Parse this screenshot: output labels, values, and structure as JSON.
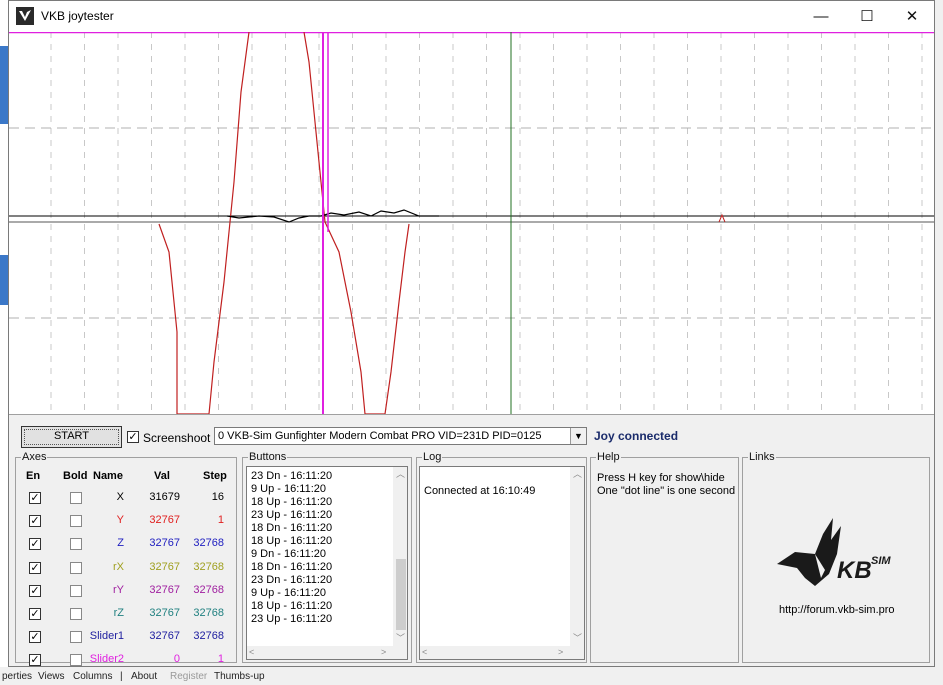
{
  "window": {
    "title": "VKB joytester",
    "minimize_glyph": "—",
    "maximize_glyph": "☐",
    "close_glyph": "✕"
  },
  "background_app": {
    "bottom_items": [
      "perties",
      "Views",
      "Columns",
      "|",
      "About",
      "Register",
      "Thumbs-up"
    ]
  },
  "toolbar": {
    "start_label": "START",
    "screenshot_label": "Screenshoot",
    "screenshot_checked": true,
    "device_value": "0  VKB-Sim Gunfighter Modern Combat PRO  VID=231D PID=0125",
    "status_text": "Joy connected"
  },
  "axes": {
    "title": "Axes",
    "headers": {
      "en": "En",
      "bold": "Bold",
      "name": "Name",
      "val": "Val",
      "step": "Step"
    },
    "rows": [
      {
        "name": "X",
        "val": "31679",
        "step": "16",
        "color": "#000000",
        "enabled": true,
        "bold": false
      },
      {
        "name": "Y",
        "val": "32767",
        "step": "1",
        "color": "#e02020",
        "enabled": true,
        "bold": false
      },
      {
        "name": "Z",
        "val": "32767",
        "step": "32768",
        "color": "#2020c0",
        "enabled": true,
        "bold": false
      },
      {
        "name": "rX",
        "val": "32767",
        "step": "32768",
        "color": "#a0a020",
        "enabled": true,
        "bold": false
      },
      {
        "name": "rY",
        "val": "32767",
        "step": "32768",
        "color": "#a020a0",
        "enabled": true,
        "bold": false
      },
      {
        "name": "rZ",
        "val": "32767",
        "step": "32768",
        "color": "#208080",
        "enabled": true,
        "bold": false
      },
      {
        "name": "Slider1",
        "val": "32767",
        "step": "32768",
        "color": "#2020a0",
        "enabled": true,
        "bold": false
      },
      {
        "name": "Slider2",
        "val": "0",
        "step": "1",
        "color": "#e020e0",
        "enabled": true,
        "bold": false
      }
    ]
  },
  "buttons": {
    "title": "Buttons",
    "events": [
      "23 Dn - 16:11:20",
      "9 Up - 16:11:20",
      "18 Up - 16:11:20",
      "23 Up - 16:11:20",
      "18 Dn - 16:11:20",
      "18 Up - 16:11:20",
      "9 Dn - 16:11:20",
      "18 Dn - 16:11:20",
      "23 Dn - 16:11:20",
      "9 Up - 16:11:20",
      "18 Up - 16:11:20",
      "23 Up - 16:11:20"
    ]
  },
  "log": {
    "title": "Log",
    "lines": [
      "Connected at 16:10:49"
    ]
  },
  "help": {
    "title": "Help",
    "lines": [
      "Press H key for show\\hide",
      "One \"dot line\" is one second"
    ]
  },
  "links": {
    "title": "Links",
    "logo_text": "VKB SIM",
    "url": "http://forum.vkb-sim.pro"
  },
  "colors": {
    "x_trace": "#000000",
    "y_trace": "#c02020",
    "slider2_marker": "#e020e0",
    "time_marker": "#207020",
    "rx_trace": "#a0a020"
  },
  "chart_data": {
    "type": "line",
    "title": "",
    "xlabel": "",
    "ylabel": "",
    "ylim": [
      0,
      65535
    ],
    "grid": true,
    "x": [
      0,
      35,
      70,
      105,
      140,
      175,
      210,
      245,
      280,
      315,
      350,
      385,
      420,
      455,
      490,
      525,
      560,
      595,
      630
    ],
    "series": [
      {
        "values": [
          null,
          null,
          null,
          null,
          null,
          32766,
          32760,
          32700,
          32500,
          32600,
          32700,
          32700,
          32600,
          32750,
          32650,
          32766,
          null,
          null,
          null
        ]
      },
      {
        "values": [
          null,
          null,
          null,
          null,
          null,
          30000,
          20000,
          5000,
          0,
          0,
          0,
          2000,
          15000,
          32767,
          60000,
          65535,
          65535,
          50000,
          35000
        ]
      },
      {
        "values": [
          null,
          null,
          null,
          null,
          null,
          null,
          null,
          null,
          null,
          null,
          null,
          null,
          null,
          null,
          null,
          null,
          null,
          null,
          null
        ]
      }
    ]
  }
}
